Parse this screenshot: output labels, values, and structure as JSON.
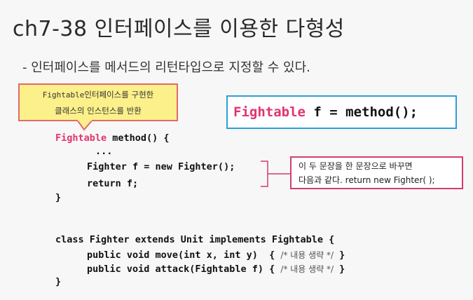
{
  "slide": {
    "title": "ch7-38 인터페이스를 이용한 다형성",
    "subtitle": "- 인터페이스를 메서드의 리턴타입으로 지정할 수 있다."
  },
  "callout": {
    "line1_mono": "Fightable",
    "line1_text": "인터페이스를 구현한",
    "line2": "클래스의 인스턴스를 반환"
  },
  "signature": {
    "type": "Fightable",
    "rest": " f = method();"
  },
  "code1": {
    "l1_type": "Fightable",
    "l1_rest": " method() {",
    "l2": "...",
    "l3": "Fighter f = new Fighter();",
    "l4": "return f;",
    "l5": "}"
  },
  "note": {
    "line1": "이 두 문장을 한 문장으로 바꾸면",
    "line2": "다음과 같다. return new Fighter( );"
  },
  "code2": {
    "l1": "class Fighter extends Unit implements Fightable {",
    "l2_code": "public void move(int x, int y)  { ",
    "l2_comment": "/* 내용 생략 */",
    "l2_end": " }",
    "l3_code": "public void attack(Fightable f) { ",
    "l3_comment": "/* 내용 생략 */",
    "l3_end": " }",
    "l4": "}"
  },
  "colors": {
    "accent_pink": "#e2336f",
    "callout_bg": "#fbf08a",
    "sigbox_border": "#2e9fd8",
    "note_border": "#d43c6e"
  }
}
